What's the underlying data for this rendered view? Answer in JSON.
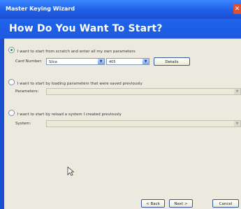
{
  "window": {
    "title": "Master Keying Wizard",
    "close_label": "✕"
  },
  "heading": "How Do You Want To Start?",
  "options": {
    "scratch": {
      "label": "I want to start from scratch and enter all my own parameters",
      "selected": true,
      "card_number_label": "Card Number:",
      "card_number_value": "Silca",
      "card_number_value2": "405",
      "details_label": "Details"
    },
    "load": {
      "label": "I want to start by loading parameters that were saved previously",
      "selected": false,
      "parameters_label": "Parameters:",
      "parameters_value": ""
    },
    "reload": {
      "label": "I want to start by reload a system I created previously",
      "selected": false,
      "system_label": "System:",
      "system_value": ""
    }
  },
  "footer": {
    "back_label": "< Back",
    "next_label": "Next >",
    "cancel_label": "Cancel"
  },
  "icons": {
    "dropdown_arrow": "chevron-down-icon",
    "cursor": "mouse-pointer-icon"
  }
}
